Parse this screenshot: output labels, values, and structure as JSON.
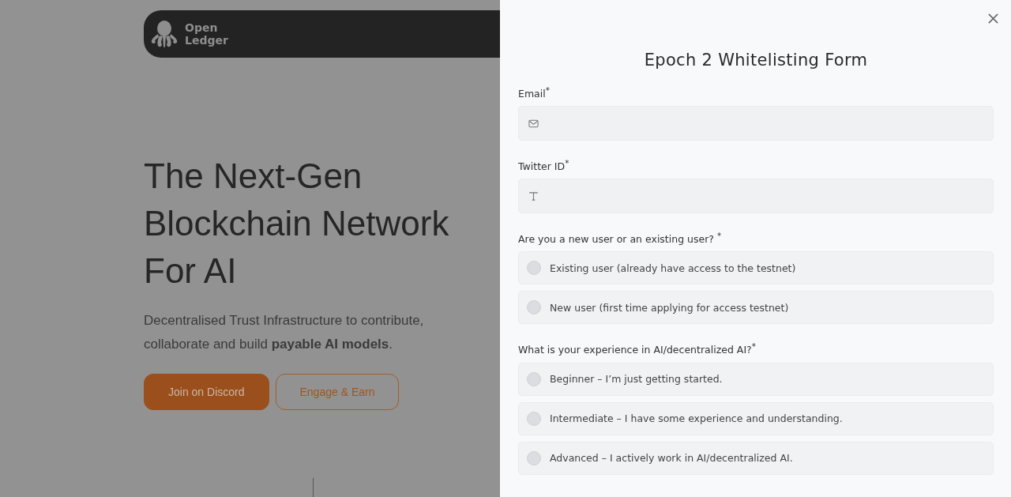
{
  "brand": {
    "name_lines": [
      "Open",
      "Ledger"
    ]
  },
  "hero": {
    "title_lines": [
      "The Next-Gen",
      "Blockchain Network",
      "For AI"
    ],
    "description": "Decentralised Trust Infrastructure to contribute, collaborate and build **payable AI models**.",
    "buttons": [
      {
        "label": "Join on Discord",
        "kind": "primary"
      },
      {
        "label": "Engage & Earn",
        "kind": "outline"
      }
    ]
  },
  "dialog": {
    "title": "Epoch 2 Whitelisting Form",
    "fields": [
      {
        "kind": "email",
        "label": "Email$^{*}$"
      },
      {
        "kind": "text",
        "label": "Twitter ID$^{*}$"
      },
      {
        "kind": "radio",
        "label": "Are you a new user or an existing user?  $^{*}$",
        "options": [
          {
            "label": "Existing user (already have access to the testnet)",
            "selected": false
          },
          {
            "label": "New user (first time applying for access testnet)",
            "selected": false
          }
        ]
      },
      {
        "kind": "radio",
        "label": "What is your experience in AI/decentralized AI?$^{*}$",
        "options": [
          {
            "label": "Beginner – I’m just getting started.",
            "selected": false
          },
          {
            "label": "Intermediate – I have some experience and understanding.",
            "selected": false
          },
          {
            "label": "Advanced – I actively work in AI/decentralized AI.",
            "selected": false
          }
        ]
      }
    ]
  }
}
